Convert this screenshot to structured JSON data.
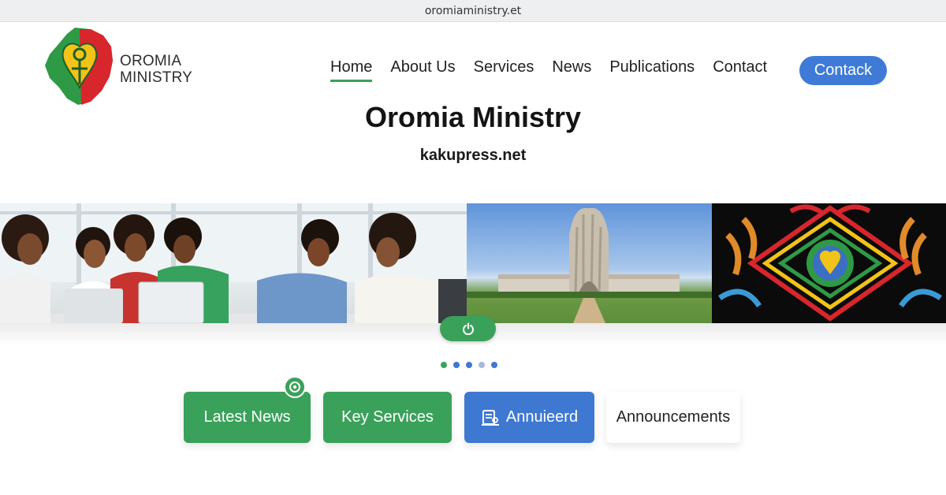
{
  "browser": {
    "url": "oromiaministry.et"
  },
  "logo": {
    "line1": "OROMIA",
    "line2": "MINISTRY"
  },
  "nav": {
    "items": [
      {
        "label": "Home",
        "active": true
      },
      {
        "label": "About Us",
        "active": false
      },
      {
        "label": "Services",
        "active": false
      },
      {
        "label": "News",
        "active": false
      },
      {
        "label": "Publications",
        "active": false
      },
      {
        "label": "Contact",
        "active": false
      }
    ],
    "cta_label": "Contack"
  },
  "hero": {
    "title": "Oromia Ministry",
    "subtitle": "kakupress.net"
  },
  "banner": {
    "panels": [
      "office-team-photo",
      "government-building-photo",
      "oromo-pattern-art"
    ],
    "control_icon": "power-icon"
  },
  "carousel": {
    "dots": [
      {
        "color": "#3aa15a",
        "active": true
      },
      {
        "color": "#3f78d1",
        "active": false
      },
      {
        "color": "#3f78d1",
        "active": false
      },
      {
        "color": "#a8b8d8",
        "active": false
      },
      {
        "color": "#3f78d1",
        "active": false
      }
    ]
  },
  "cards": {
    "latest_news": "Latest News",
    "key_services": "Key Services",
    "annuieerd": "Annuieerd",
    "announcements": "Announcements"
  },
  "colors": {
    "green": "#3aa15a",
    "blue": "#3f78d1",
    "red": "#d8262d",
    "yellow": "#f2c318"
  }
}
